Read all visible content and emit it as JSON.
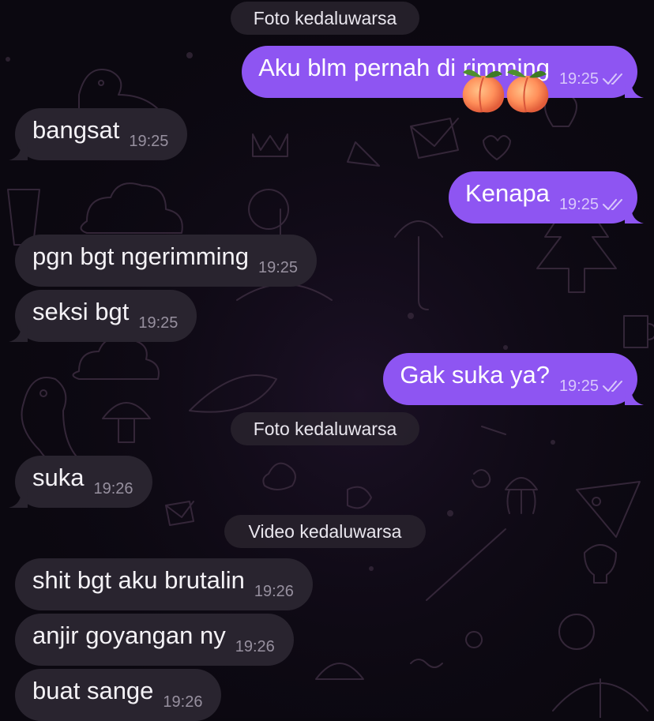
{
  "colors": {
    "background": "#0b0810",
    "incoming_bubble": "#29242f",
    "outgoing_bubble": "#8e55f2",
    "service_pill": "#28222c",
    "read_checks": "#d9c8fb"
  },
  "chat": {
    "services": [
      {
        "text": "Foto kedaluwarsa"
      },
      {
        "text": "Foto kedaluwarsa"
      },
      {
        "text": "Video kedaluwarsa"
      }
    ],
    "messages": [
      {
        "direction": "out",
        "text": "Aku blm pernah di rimming",
        "time": "19:25",
        "status": "read",
        "emoji": [
          "peach-icon",
          "peach-icon"
        ]
      },
      {
        "direction": "in",
        "text": "bangsat",
        "time": "19:25"
      },
      {
        "direction": "out",
        "text": "Kenapa",
        "time": "19:25",
        "status": "read"
      },
      {
        "direction": "in",
        "text": "pgn bgt ngerimming",
        "time": "19:25"
      },
      {
        "direction": "in",
        "text": "seksi bgt",
        "time": "19:25"
      },
      {
        "direction": "out",
        "text": "Gak suka ya?",
        "time": "19:25",
        "status": "read"
      },
      {
        "direction": "in",
        "text": "suka",
        "time": "19:26"
      },
      {
        "direction": "in",
        "text": "shit bgt aku brutalin",
        "time": "19:26"
      },
      {
        "direction": "in",
        "text": "anjir goyangan ny",
        "time": "19:26"
      },
      {
        "direction": "in",
        "text": "buat sange",
        "time": "19:26"
      }
    ]
  }
}
